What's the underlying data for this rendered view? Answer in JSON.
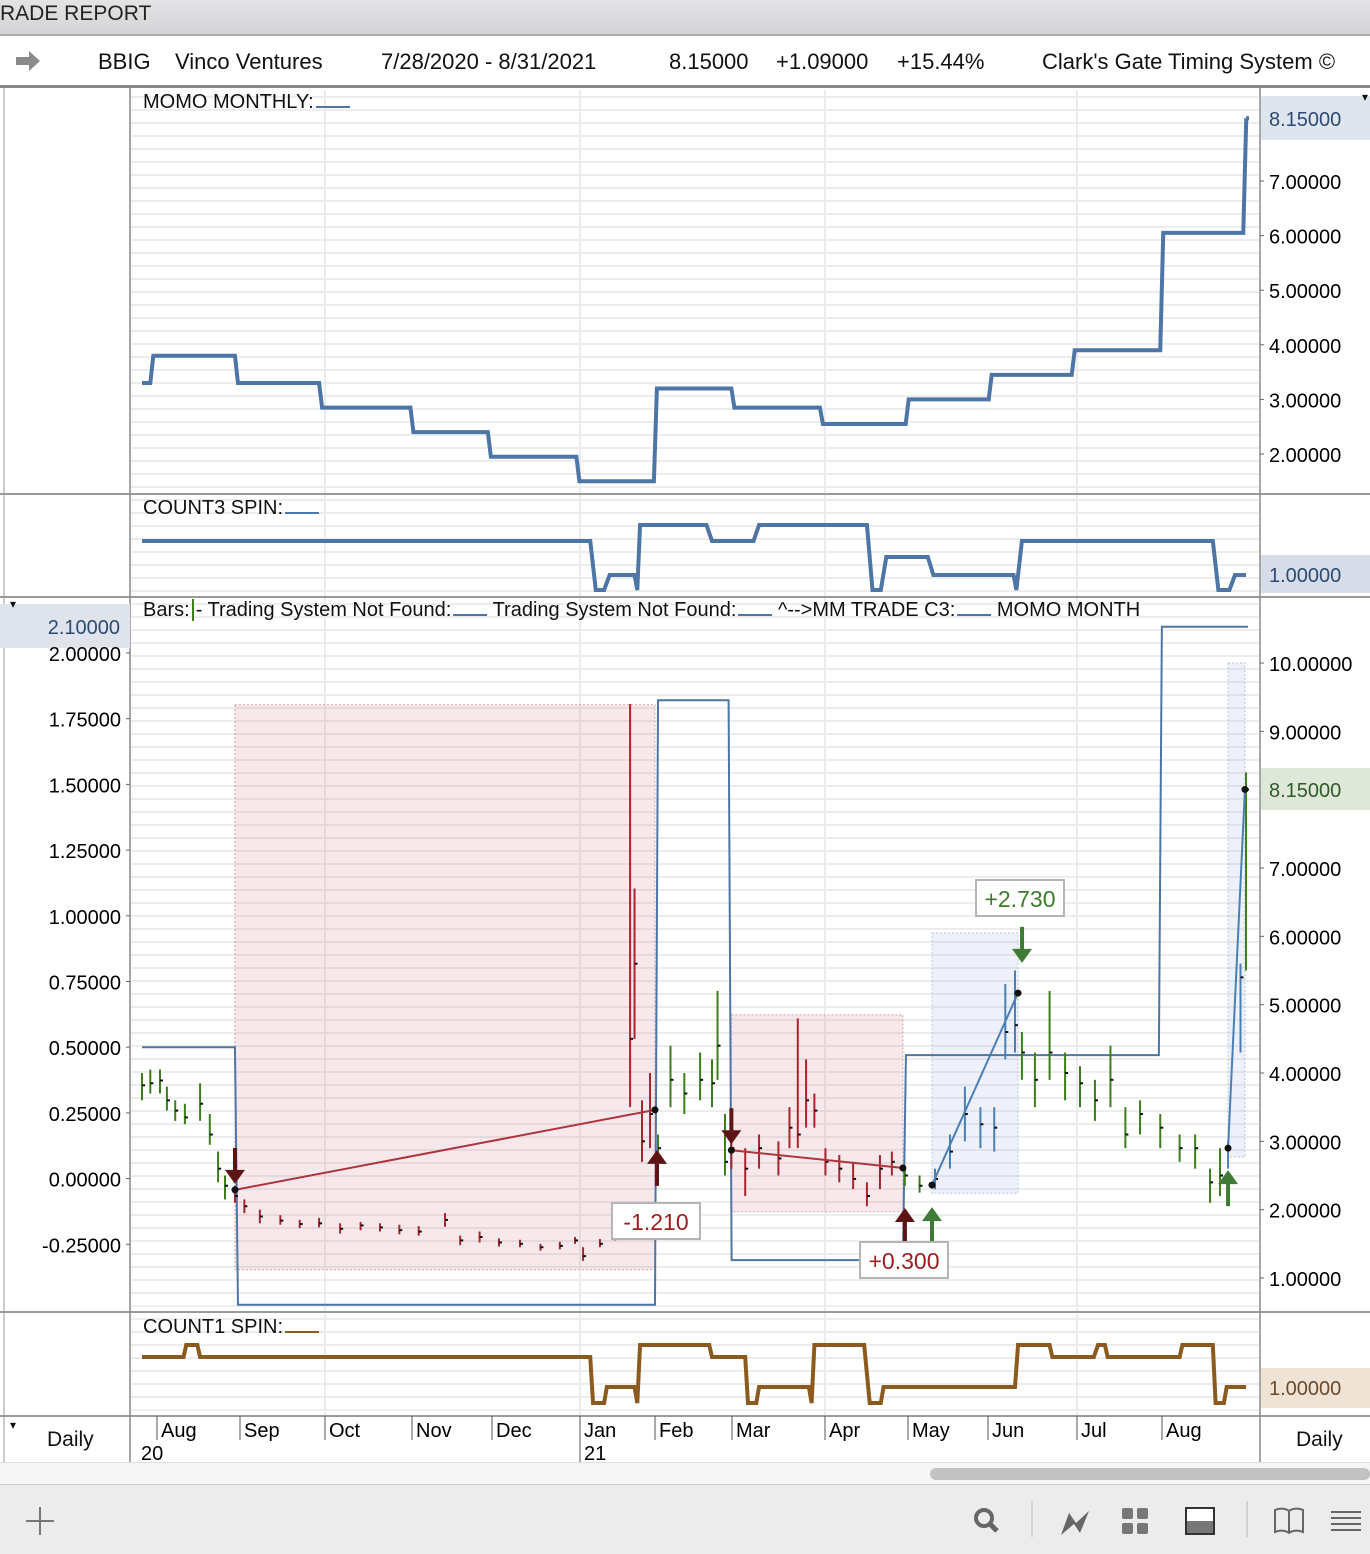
{
  "window": {
    "title": "RADE REPORT"
  },
  "header": {
    "symbol": "BBIG",
    "company": "Vinco Ventures",
    "date_range": "7/28/2020 - 8/31/2021",
    "last": "8.15000",
    "change": "+1.09000",
    "change_pct": "+15.44%",
    "system": "Clark's Gate Timing System ©"
  },
  "colors": {
    "momo": "#4d75a6",
    "count1": "#8b5a1e",
    "bar_red": "#a8252f",
    "bar_green": "#3c7d1c",
    "bar_blue": "#4a7fb5",
    "arrow_red": "#5e1414",
    "arrow_green": "#3f7a36"
  },
  "panes": {
    "momo_monthly": {
      "label": "MOMO MONTHLY:",
      "current": "8.15000",
      "ticks": [
        "7.00000",
        "6.00000",
        "5.00000",
        "4.00000",
        "3.00000",
        "2.00000"
      ]
    },
    "count3": {
      "label": "COUNT3 SPIN:",
      "current": "1.00000"
    },
    "main": {
      "legend": [
        "Bars:",
        "- Trading System Not Found:",
        "Trading System Not Found:",
        "^-->MM TRADE C3:",
        "MOMO MONTH"
      ],
      "left_current": "2.10000",
      "left_ticks": [
        "2.00000",
        "1.75000",
        "1.50000",
        "1.25000",
        "1.00000",
        "0.75000",
        "0.50000",
        "0.25000",
        "0.00000",
        "-0.25000"
      ],
      "right_current": "8.15000",
      "right_ticks": [
        "10.00000",
        "9.00000",
        "7.00000",
        "6.00000",
        "5.00000",
        "4.00000",
        "3.00000",
        "2.00000",
        "1.00000"
      ]
    },
    "count1": {
      "label": "COUNT1 SPIN:",
      "current": "1.00000"
    }
  },
  "date_axis": {
    "period_left": "Daily",
    "period_right": "Daily",
    "months": [
      "Aug",
      "Sep",
      "Oct",
      "Nov",
      "Dec",
      "Jan",
      "Feb",
      "Mar",
      "Apr",
      "May",
      "Jun",
      "Jul",
      "Aug"
    ],
    "years": [
      "20",
      "21"
    ]
  },
  "toolbar": {
    "buttons": [
      "add",
      "search",
      "chart-style",
      "layout-grid",
      "panel",
      "book",
      "menu"
    ]
  },
  "chart_data": {
    "type": "line",
    "x_unit": "calendar days since 7/28/2020",
    "momo_monthly": [
      [
        0,
        3.3
      ],
      [
        3,
        3.8
      ],
      [
        33.6,
        3.3
      ],
      [
        64,
        2.85
      ],
      [
        97,
        2.4
      ],
      [
        125,
        1.95
      ],
      [
        157,
        1.5
      ],
      [
        185,
        3.2
      ],
      [
        213,
        2.85
      ],
      [
        245,
        2.55
      ],
      [
        276,
        3.0
      ],
      [
        306,
        3.45
      ],
      [
        336,
        3.9
      ],
      [
        368,
        6.05
      ],
      [
        398,
        8.15
      ],
      [
        399,
        8.15
      ]
    ],
    "count3_spin": [
      [
        0,
        3
      ],
      [
        162,
        3
      ],
      [
        164,
        0
      ],
      [
        167,
        0
      ],
      [
        169,
        1
      ],
      [
        178,
        1
      ],
      [
        179,
        0
      ],
      [
        180,
        4
      ],
      [
        204,
        4
      ],
      [
        206,
        3
      ],
      [
        221,
        3
      ],
      [
        223,
        4
      ],
      [
        262,
        4
      ],
      [
        264,
        0
      ],
      [
        267,
        0
      ],
      [
        269,
        2
      ],
      [
        284,
        2
      ],
      [
        286,
        1
      ],
      [
        315,
        1
      ],
      [
        316,
        0
      ],
      [
        318,
        3
      ],
      [
        387,
        3
      ],
      [
        389,
        0
      ],
      [
        393,
        0
      ],
      [
        395,
        1
      ],
      [
        399,
        1
      ]
    ],
    "count1_spin": [
      [
        0,
        3
      ],
      [
        15,
        3
      ],
      [
        16,
        4
      ],
      [
        20,
        4
      ],
      [
        21,
        3
      ],
      [
        162,
        3
      ],
      [
        163,
        0
      ],
      [
        167,
        0
      ],
      [
        168,
        1
      ],
      [
        178,
        1
      ],
      [
        179,
        0
      ],
      [
        180,
        4
      ],
      [
        205,
        4
      ],
      [
        206,
        3
      ],
      [
        218,
        3
      ],
      [
        219,
        0
      ],
      [
        222,
        0
      ],
      [
        223,
        1
      ],
      [
        241,
        1
      ],
      [
        242,
        0
      ],
      [
        243,
        4
      ],
      [
        261,
        4
      ],
      [
        263,
        0
      ],
      [
        267,
        0
      ],
      [
        268,
        1
      ],
      [
        285,
        1
      ],
      [
        315.5,
        1
      ],
      [
        316.6,
        4
      ],
      [
        328,
        4
      ],
      [
        329,
        3
      ],
      [
        344,
        3
      ],
      [
        345.5,
        4
      ],
      [
        348,
        4
      ],
      [
        349,
        3
      ],
      [
        375,
        3
      ],
      [
        376,
        4
      ],
      [
        387,
        4
      ],
      [
        388,
        0
      ],
      [
        391,
        0
      ],
      [
        392,
        1
      ],
      [
        399,
        1
      ]
    ],
    "momo_month_main": [
      [
        0,
        0.5
      ],
      [
        33.6,
        -0.48
      ],
      [
        185.4,
        1.82
      ],
      [
        212,
        -0.31
      ],
      [
        275,
        0.47
      ],
      [
        367.5,
        2.1
      ],
      [
        398.6,
        2.1
      ]
    ],
    "bars": [
      [
        0,
        3.82,
        4.0,
        3.6
      ],
      [
        3,
        3.85,
        4.05,
        3.7
      ],
      [
        6.5,
        3.89,
        4.05,
        3.7
      ],
      [
        9,
        3.6,
        3.8,
        3.45
      ],
      [
        12,
        3.45,
        3.6,
        3.3
      ],
      [
        15.5,
        3.35,
        3.55,
        3.25
      ],
      [
        21,
        3.55,
        3.85,
        3.3
      ],
      [
        24.5,
        3.1,
        3.4,
        2.95
      ],
      [
        27.5,
        2.6,
        2.85,
        2.4
      ],
      [
        30,
        2.35,
        2.5,
        2.15
      ],
      [
        33.6,
        2.2,
        2.35,
        2.1
      ],
      [
        37,
        2.05,
        2.15,
        1.95
      ],
      [
        42.6,
        1.9,
        2.0,
        1.8
      ],
      [
        50,
        1.84,
        1.92,
        1.78
      ],
      [
        57,
        1.79,
        1.85,
        1.73
      ],
      [
        64,
        1.8,
        1.88,
        1.74
      ],
      [
        71.6,
        1.72,
        1.8,
        1.65
      ],
      [
        79,
        1.77,
        1.82,
        1.7
      ],
      [
        86,
        1.74,
        1.8,
        1.68
      ],
      [
        93,
        1.7,
        1.78,
        1.64
      ],
      [
        100,
        1.68,
        1.76,
        1.62
      ],
      [
        109.5,
        1.85,
        1.95,
        1.75
      ],
      [
        115,
        1.55,
        1.62,
        1.48
      ],
      [
        122,
        1.6,
        1.68,
        1.52
      ],
      [
        129,
        1.52,
        1.58,
        1.46
      ],
      [
        136.6,
        1.5,
        1.56,
        1.45
      ],
      [
        144,
        1.45,
        1.5,
        1.4
      ],
      [
        151,
        1.47,
        1.53,
        1.42
      ],
      [
        156.5,
        1.55,
        1.6,
        1.5
      ],
      [
        159.4,
        1.32,
        1.45,
        1.25
      ],
      [
        165.5,
        1.5,
        1.57,
        1.45
      ],
      [
        171,
        1.6,
        1.7,
        1.55
      ],
      [
        176.4,
        4.5,
        9.4,
        3.5
      ],
      [
        178,
        5.6,
        6.7,
        4.5
      ],
      [
        180.7,
        3.0,
        3.6,
        2.7
      ],
      [
        183.6,
        3.4,
        4.0,
        2.9
      ],
      [
        186.5,
        2.9,
        3.1,
        2.7
      ],
      [
        191,
        3.9,
        4.4,
        3.5
      ],
      [
        196,
        3.7,
        4.0,
        3.4
      ],
      [
        201.7,
        3.9,
        4.3,
        3.6
      ],
      [
        206,
        3.85,
        4.2,
        3.5
      ],
      [
        208,
        4.4,
        5.2,
        3.9
      ],
      [
        210.7,
        2.7,
        3.4,
        2.5
      ],
      [
        213,
        2.9,
        3.3,
        2.6
      ],
      [
        218,
        2.6,
        2.9,
        2.2
      ],
      [
        223,
        2.9,
        3.1,
        2.6
      ],
      [
        230,
        2.75,
        3.0,
        2.5
      ],
      [
        234,
        3.2,
        3.5,
        2.9
      ],
      [
        237,
        3.1,
        4.8,
        2.9
      ],
      [
        240,
        3.6,
        4.2,
        3.2
      ],
      [
        243,
        3.45,
        3.7,
        3.2
      ],
      [
        247,
        2.7,
        2.9,
        2.5
      ],
      [
        252,
        2.6,
        2.8,
        2.4
      ],
      [
        257,
        2.45,
        2.7,
        2.3
      ],
      [
        262,
        2.2,
        2.4,
        2.05
      ],
      [
        266.7,
        2.6,
        2.8,
        2.3
      ],
      [
        271,
        2.7,
        2.85,
        2.5
      ],
      [
        275.7,
        2.5,
        2.6,
        2.35
      ],
      [
        281,
        2.35,
        2.5,
        2.25
      ],
      [
        286.6,
        2.45,
        2.6,
        2.3
      ],
      [
        292,
        2.85,
        3.1,
        2.6
      ],
      [
        297.4,
        3.4,
        3.8,
        3.0
      ],
      [
        303,
        3.25,
        3.5,
        2.9
      ],
      [
        308,
        3.2,
        3.5,
        2.85
      ],
      [
        312,
        4.6,
        5.3,
        4.2
      ],
      [
        315.5,
        4.7,
        5.5,
        4.3
      ],
      [
        318,
        4.3,
        4.6,
        3.9
      ],
      [
        322.7,
        3.9,
        4.3,
        3.5
      ],
      [
        328,
        4.3,
        5.2,
        3.9
      ],
      [
        333.6,
        4.0,
        4.3,
        3.6
      ],
      [
        339,
        3.85,
        4.1,
        3.5
      ],
      [
        344.4,
        3.6,
        3.9,
        3.3
      ],
      [
        350,
        3.9,
        4.4,
        3.5
      ],
      [
        355.4,
        3.1,
        3.5,
        2.9
      ],
      [
        360.7,
        3.4,
        3.6,
        3.1
      ],
      [
        368,
        3.2,
        3.4,
        2.9
      ],
      [
        375,
        2.9,
        3.1,
        2.7
      ],
      [
        380.6,
        2.9,
        3.1,
        2.6
      ],
      [
        386,
        2.4,
        2.6,
        2.1
      ],
      [
        389.6,
        2.5,
        2.9,
        2.2
      ],
      [
        392.5,
        2.9,
        3.0,
        2.6
      ],
      [
        397,
        5.4,
        5.6,
        4.3
      ],
      [
        399,
        8.15,
        8.4,
        5.5
      ]
    ],
    "trades": [
      {
        "side": "short",
        "entry_day": 33.6,
        "exit_day": 185.4,
        "box_high": 9.39,
        "box_low": 1.12,
        "entry_price": 2.29,
        "exit_price": 3.46,
        "result": "-1.210",
        "color": "red"
      },
      {
        "side": "short",
        "entry_day": 213,
        "exit_day": 275,
        "box_high": 4.85,
        "box_low": 1.97,
        "entry_price": 2.87,
        "exit_price": 2.61,
        "result": "+0.300",
        "color": "red"
      },
      {
        "side": "long",
        "entry_day": 285.5,
        "exit_day": 316.6,
        "box_high": 6.05,
        "box_low": 2.24,
        "entry_price": 2.36,
        "exit_price": 5.17,
        "result": "+2.730",
        "color": "blue"
      },
      {
        "side": "long",
        "entry_day": 392.5,
        "exit_day": 398.6,
        "box_high": 10.0,
        "box_low": 2.77,
        "entry_price": 2.9,
        "exit_price": 8.15,
        "result": "",
        "color": "blue"
      }
    ]
  }
}
